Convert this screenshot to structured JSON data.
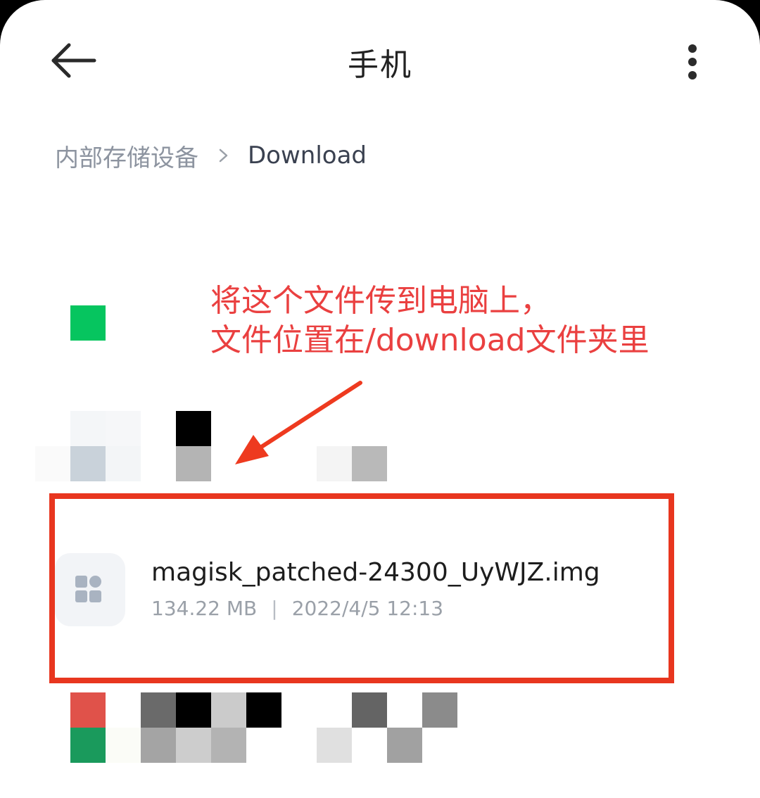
{
  "header": {
    "title": "手机"
  },
  "breadcrumb": {
    "root": "内部存储设备",
    "current": "Download"
  },
  "annotation": {
    "line1": "将这个文件传到电脑上，",
    "line2": "文件位置在/download文件夹里"
  },
  "file": {
    "name": "magisk_patched-24300_UyWJZ.img",
    "size": "134.22 MB",
    "separator": "|",
    "date": "2022/4/5 12:13",
    "icon": "grid-apps-icon"
  },
  "colors": {
    "annotation_red": "#ea4040",
    "highlight_box": "#e8361f",
    "folder_green": "#06c55f"
  }
}
